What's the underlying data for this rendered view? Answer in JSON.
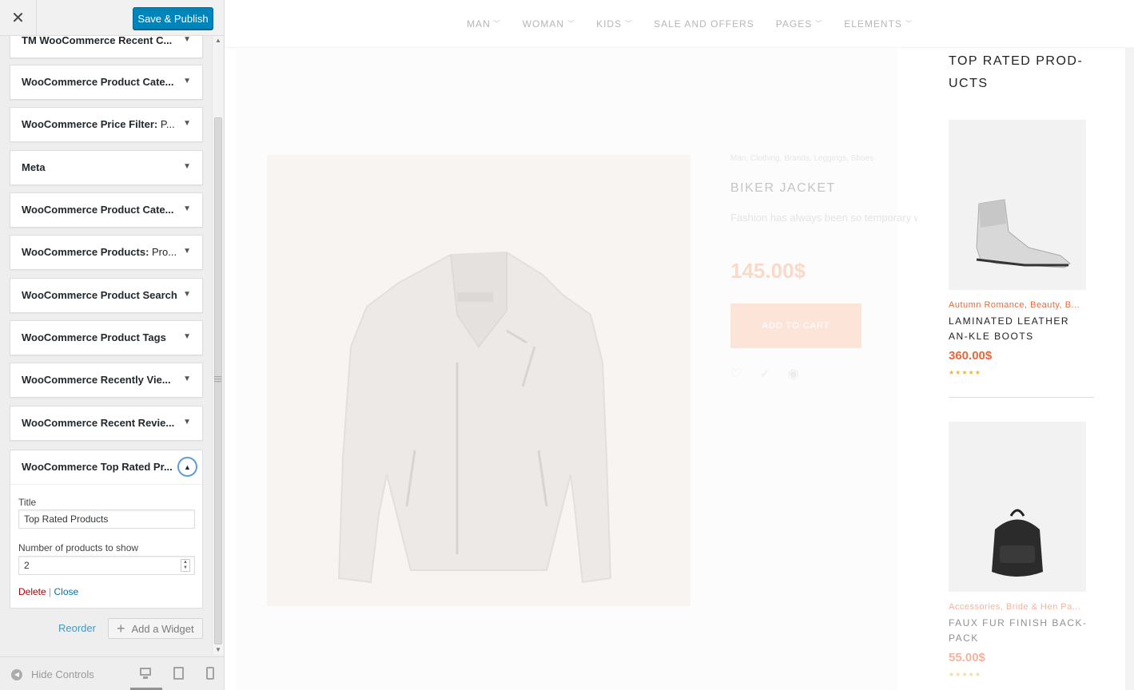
{
  "customizer": {
    "close_glyph": "✕",
    "publish_label": "Save & Publish",
    "widgets": [
      {
        "title": "TM WooCommerce Recent C...",
        "sub": ""
      },
      {
        "title": "WooCommerce Product Cate...",
        "sub": ""
      },
      {
        "title": "WooCommerce Price Filter: ",
        "sub": "P..."
      },
      {
        "title": "Meta",
        "sub": ""
      },
      {
        "title": "WooCommerce Product Cate...",
        "sub": ""
      },
      {
        "title": "WooCommerce Products: ",
        "sub": "Pro..."
      },
      {
        "title": "WooCommerce Product Search",
        "sub": ""
      },
      {
        "title": "WooCommerce Product Tags",
        "sub": ""
      },
      {
        "title": "WooCommerce Recently Vie...",
        "sub": ""
      },
      {
        "title": "WooCommerce Recent Revie...",
        "sub": ""
      }
    ],
    "open_widget": {
      "title": "WooCommerce Top Rated Pr...",
      "title_label": "Title",
      "title_value": "Top Rated Products",
      "count_label": "Number of products to show",
      "count_value": "2",
      "delete_label": "Delete",
      "separator": "|",
      "close_label": "Close"
    },
    "reorder_label": "Reorder",
    "add_widget_label": "Add a Widget",
    "hide_controls_label": "Hide Controls"
  },
  "site": {
    "nav": [
      {
        "label": "MAN",
        "dropdown": true
      },
      {
        "label": "WOMAN",
        "dropdown": true
      },
      {
        "label": "KIDS",
        "dropdown": true
      },
      {
        "label": "SALE AND OFFERS",
        "dropdown": false
      },
      {
        "label": "PAGES",
        "dropdown": true
      },
      {
        "label": "ELEMENTS",
        "dropdown": true
      }
    ],
    "quickview": {
      "categories": "Man, Clothing, Brands, Leggings, Shoes",
      "title": "BIKER JACKET",
      "description": "Fashion has always been so temporary with it.",
      "price": "145.00$",
      "add_to_cart": "ADD TO CART"
    },
    "sidebar": {
      "title": "TOP RATED PROD-UCTS",
      "products": [
        {
          "categories": "Autumn Romance, Beauty, B...",
          "name": "LAMINATED LEATHER AN-KLE BOOTS",
          "price": "360.00$",
          "rating": "★★★★★"
        },
        {
          "categories": "Accessories, Bride & Hen Pa...",
          "name": "FAUX FUR FINISH BACK-PACK",
          "price": "55.00$",
          "rating": "★★★★★"
        }
      ]
    }
  }
}
